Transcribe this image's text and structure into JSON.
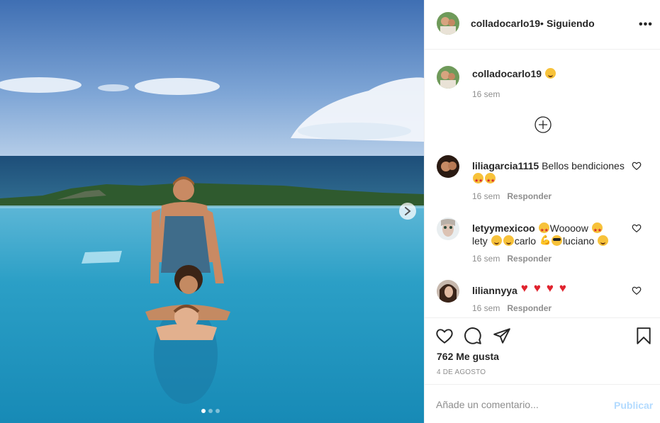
{
  "post": {
    "username": "colladocarlo19",
    "separator": "•",
    "follow_status": "Siguiendo",
    "more_label": "•••",
    "caption_user": "colladocarlo19",
    "caption_time": "16 sem",
    "carousel": {
      "slides": 3,
      "active": 1
    }
  },
  "comments": [
    {
      "user": "liliagarcia1115",
      "text": "Bellos bendiciones",
      "line2_emojis": [
        "star-struck",
        "star-struck"
      ],
      "time": "16 sem",
      "reply": "Responder"
    },
    {
      "user": "letyymexicoo",
      "text_a": "Woooow",
      "text_b": "lety",
      "text_c": "carlo",
      "text_d": "luciano",
      "time": "16 sem",
      "reply": "Responder"
    },
    {
      "user": "liliannyya",
      "emojis": [
        "heart",
        "heart",
        "heart",
        "heart"
      ],
      "time": "16 sem",
      "reply": "Responder"
    }
  ],
  "actions": {
    "likes": "762 Me gusta",
    "date": "4 DE AGOSTO"
  },
  "composer": {
    "placeholder": "Añade un comentario...",
    "publish_label": "Publicar"
  },
  "colors": {
    "text": "#262626",
    "muted": "#8e8e8e",
    "border": "#efefef",
    "publish_disabled": "#b3dbff",
    "heart_red": "#e0232e"
  },
  "icons": [
    "more-options-icon",
    "add-circle-icon",
    "heart-icon",
    "comment-icon",
    "share-icon",
    "save-icon",
    "next-arrow-icon"
  ]
}
